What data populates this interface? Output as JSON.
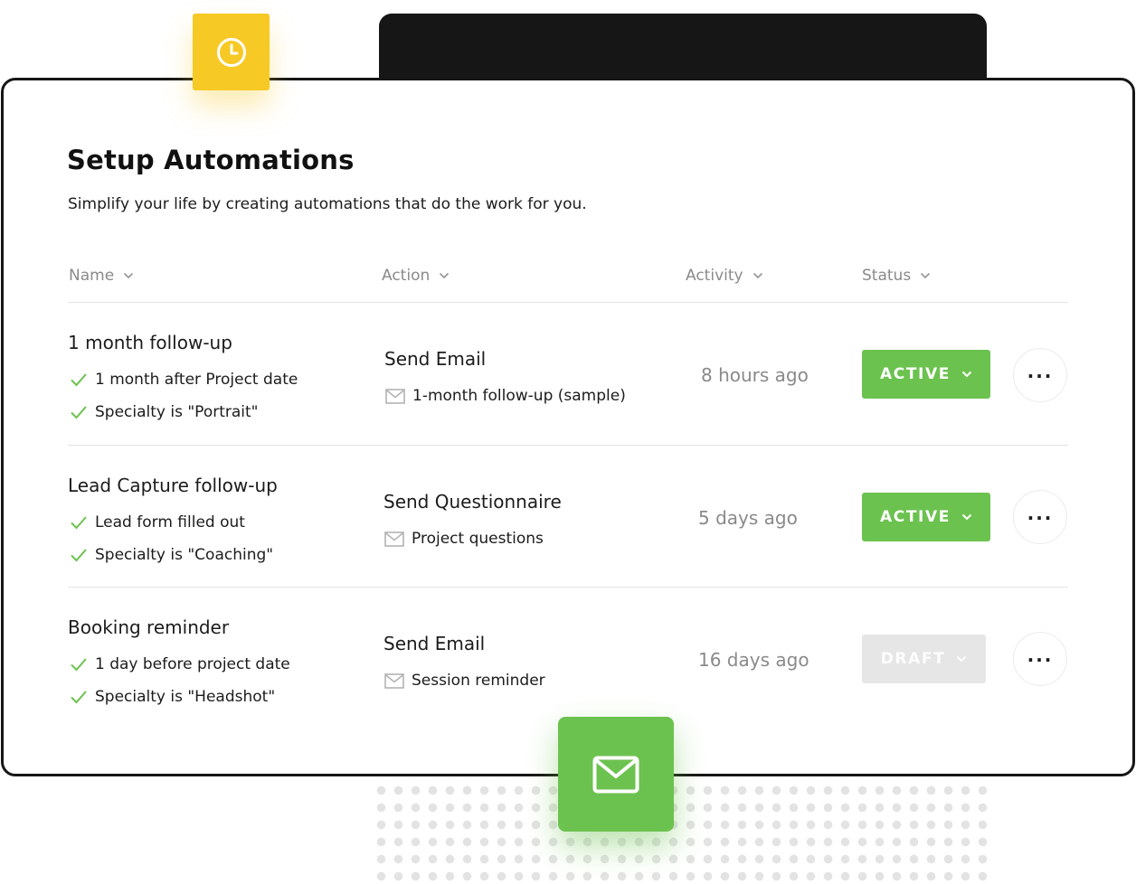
{
  "header": {
    "title": "Setup Automations",
    "subtitle": "Simplify your life by creating automations that do the work for you."
  },
  "columns": {
    "name": "Name",
    "action": "Action",
    "activity": "Activity",
    "status": "Status"
  },
  "rows": [
    {
      "name": "1 month follow-up",
      "conditions": [
        "1 month after Project date",
        "Specialty is \"Portrait\""
      ],
      "action": "Send Email",
      "action_item": "1-month follow-up (sample)",
      "activity": "8 hours ago",
      "status": "ACTIVE"
    },
    {
      "name": "Lead Capture follow-up",
      "conditions": [
        "Lead form filled out",
        "Specialty is \"Coaching\""
      ],
      "action": "Send Questionnaire",
      "action_item": "Project questions",
      "activity": "5 days ago",
      "status": "ACTIVE"
    },
    {
      "name": "Booking reminder",
      "conditions": [
        "1 day before project date",
        "Specialty is \"Headshot\""
      ],
      "action": "Send Email",
      "action_item": "Session reminder",
      "activity": "16 days ago",
      "status": "DRAFT"
    }
  ],
  "more_label": "...",
  "icons": {
    "clock_badge": "clock-icon",
    "mail_badge": "mail-icon",
    "condition": "check-icon",
    "action_item": "envelope-icon",
    "sort": "chevron-down-icon"
  },
  "colors": {
    "accent_green": "#6cc24f",
    "accent_yellow": "#f7c925",
    "draft_gray": "#e6e6e6",
    "frame_black": "#161616"
  }
}
